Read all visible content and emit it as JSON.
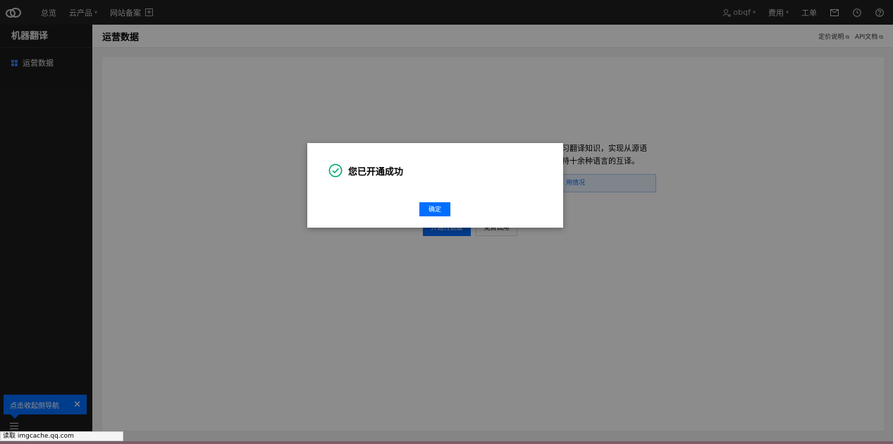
{
  "topnav": {
    "logo": "tencent-cloud-logo",
    "items": [
      {
        "label": "总览"
      },
      {
        "label": "云产品",
        "caret": "▾"
      },
      {
        "label": "网站备案"
      }
    ],
    "plus": "+",
    "right": {
      "account": "obqf",
      "account_caret": "▾",
      "billing": "费用",
      "billing_caret": "▾",
      "ticket": "工单"
    }
  },
  "sidebar": {
    "title": "机器翻译",
    "items": [
      {
        "label": "运营数据",
        "icon": "grid-icon"
      }
    ],
    "collapse_tip": "点击收起侧导航",
    "collapse_close": "✕"
  },
  "pagehead": {
    "title": "运营数据",
    "links": [
      {
        "label": "定价说明",
        "ext": "⧉"
      },
      {
        "label": "API文档",
        "ext": "⧉"
      }
    ]
  },
  "content": {
    "intro_line1": "学习翻译知识，实现从源语",
    "intro_line2": "支持十余种语言的互译。",
    "usage_link": "用情况",
    "open_button": "开通付费版",
    "trial_button": "免费试用"
  },
  "modal": {
    "message": "您已开通成功",
    "ok_label": "确定",
    "icon": "check-circle-icon",
    "success_color": "#00a870"
  },
  "statusbar": {
    "text": "读取 imgcache.qq.com"
  },
  "colors": {
    "primary": "#006eff",
    "nav_bg": "#1f1f1f",
    "sidebar_bg": "#1b1b1b"
  }
}
